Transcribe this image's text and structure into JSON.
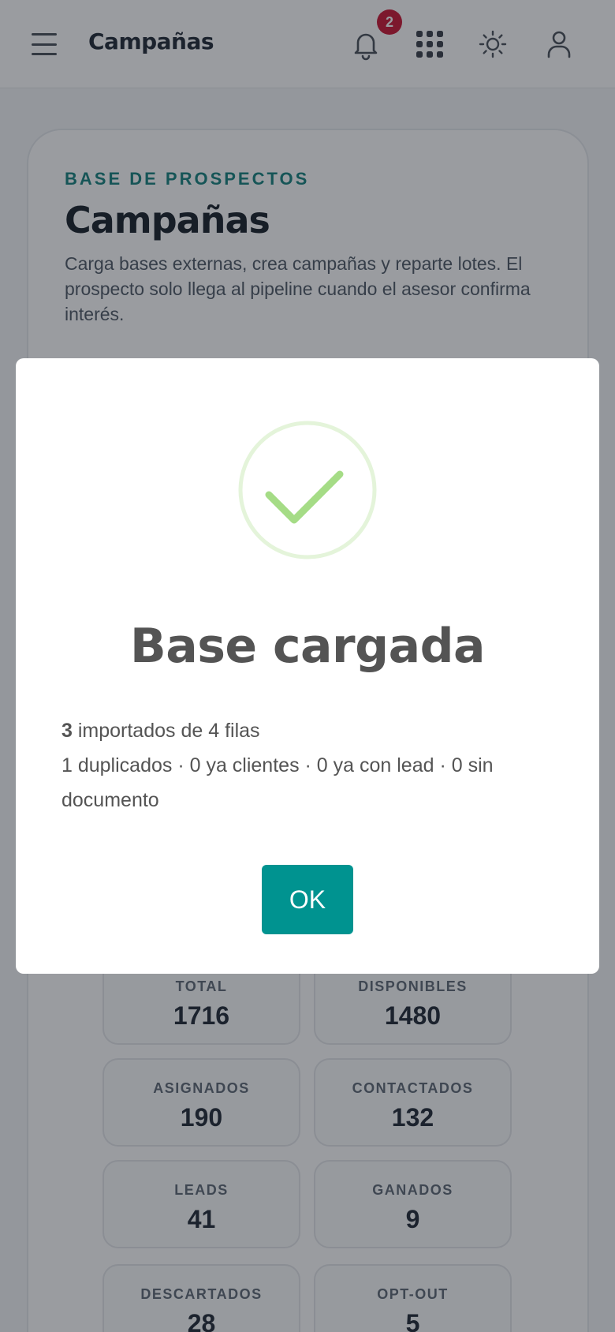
{
  "header": {
    "title": "Campañas",
    "notification_count": "2",
    "icons": [
      "menu-icon",
      "bell-icon",
      "apps-grid-icon",
      "sun-icon",
      "user-icon"
    ]
  },
  "page": {
    "eyebrow": "BASE DE PROSPECTOS",
    "title": "Campañas",
    "description": "Carga bases externas, crea campañas y reparte lotes. El prospecto solo llega al pipeline cuando el asesor confirma interés."
  },
  "stats": [
    {
      "label": "TOTAL",
      "value": "1716"
    },
    {
      "label": "DISPONIBLES",
      "value": "1480"
    },
    {
      "label": "ASIGNADOS",
      "value": "190"
    },
    {
      "label": "CONTACTADOS",
      "value": "132"
    },
    {
      "label": "LEADS",
      "value": "41"
    },
    {
      "label": "GANADOS",
      "value": "9"
    },
    {
      "label": "DESCARTADOS",
      "value": "28"
    },
    {
      "label": "OPT-OUT",
      "value": "5"
    }
  ],
  "modal": {
    "title": "Base cargada",
    "imported_count": "3",
    "imported_text": " importados de 4 filas",
    "detail": "1 duplicados · 0 ya clientes · 0 ya con lead · 0 sin documento",
    "ok_label": "OK",
    "icon": "success-check-icon"
  },
  "colors": {
    "accent": "#0f7f7a",
    "ok_button": "#009390",
    "badge": "#c8102e",
    "success": "#a5dc86"
  }
}
